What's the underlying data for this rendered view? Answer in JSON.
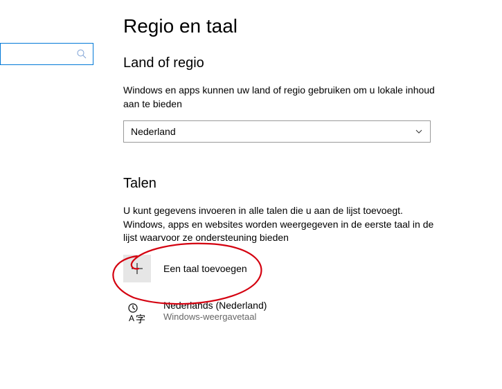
{
  "search": {
    "placeholder": ""
  },
  "page": {
    "title": "Regio en taal"
  },
  "region": {
    "header": "Land of regio",
    "description": "Windows en apps kunnen uw land of regio gebruiken om u lokale inhoud aan te bieden",
    "selected": "Nederland"
  },
  "languages": {
    "header": "Talen",
    "description": "U kunt gegevens invoeren in alle talen die u aan de lijst toevoegt. Windows, apps en websites worden weergegeven in de eerste taal in de lijst waarvoor ze ondersteuning bieden",
    "addLabel": "Een taal toevoegen",
    "items": [
      {
        "name": "Nederlands (Nederland)",
        "subtitle": "Windows-weergavetaal"
      }
    ]
  }
}
